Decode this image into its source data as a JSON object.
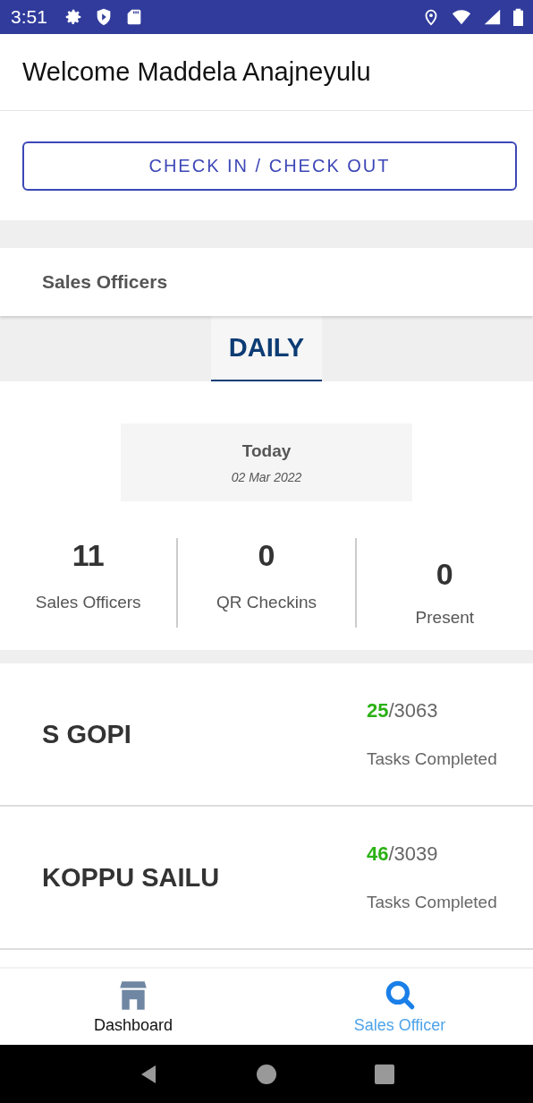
{
  "status_bar": {
    "time": "3:51"
  },
  "header": {
    "title": "Welcome Maddela Anajneyulu"
  },
  "check_button": {
    "label": "CHECK IN / CHECK OUT"
  },
  "section": {
    "title": "Sales Officers"
  },
  "tabs": [
    {
      "label": "DAILY",
      "selected": true
    }
  ],
  "date_card": {
    "title": "Today",
    "date": "02 Mar 2022"
  },
  "stats": [
    {
      "value": "11",
      "label": "Sales Officers"
    },
    {
      "value": "0",
      "label": "QR Checkins"
    },
    {
      "value": "0",
      "label": "Present"
    }
  ],
  "officers": [
    {
      "name": "S GOPI",
      "done": "25",
      "total": "/3063",
      "caption": "Tasks Completed"
    },
    {
      "name": "KOPPU SAILU",
      "done": "46",
      "total": "/3039",
      "caption": "Tasks Completed"
    }
  ],
  "bottom_nav": [
    {
      "label": "Dashboard",
      "kind": "store",
      "selected": false
    },
    {
      "label": "Sales Officer",
      "kind": "search",
      "selected": true
    }
  ]
}
